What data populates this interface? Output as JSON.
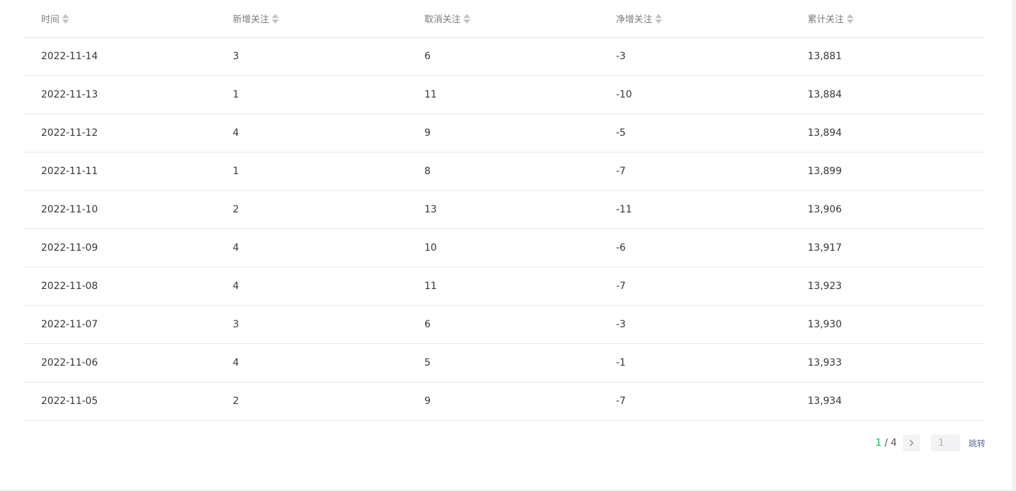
{
  "table": {
    "headers": [
      "时间",
      "新增关注",
      "取消关注",
      "净增关注",
      "累计关注"
    ],
    "rows": [
      [
        "2022-11-14",
        "3",
        "6",
        "-3",
        "13,881"
      ],
      [
        "2022-11-13",
        "1",
        "11",
        "-10",
        "13,884"
      ],
      [
        "2022-11-12",
        "4",
        "9",
        "-5",
        "13,894"
      ],
      [
        "2022-11-11",
        "1",
        "8",
        "-7",
        "13,899"
      ],
      [
        "2022-11-10",
        "2",
        "13",
        "-11",
        "13,906"
      ],
      [
        "2022-11-09",
        "4",
        "10",
        "-6",
        "13,917"
      ],
      [
        "2022-11-08",
        "4",
        "11",
        "-7",
        "13,923"
      ],
      [
        "2022-11-07",
        "3",
        "6",
        "-3",
        "13,930"
      ],
      [
        "2022-11-06",
        "4",
        "5",
        "-1",
        "13,933"
      ],
      [
        "2022-11-05",
        "2",
        "9",
        "-7",
        "13,934"
      ]
    ]
  },
  "pagination": {
    "current_page": "1",
    "separator": "/",
    "total_pages": "4",
    "jump_placeholder": "1",
    "jump_label": "跳转",
    "next_icon": "chevron-right-icon"
  },
  "colors": {
    "accent": "#07c160",
    "link": "#576b95",
    "header_text": "#7a7a7a",
    "cell_text": "#353535",
    "row_border": "#e7e7e7"
  }
}
